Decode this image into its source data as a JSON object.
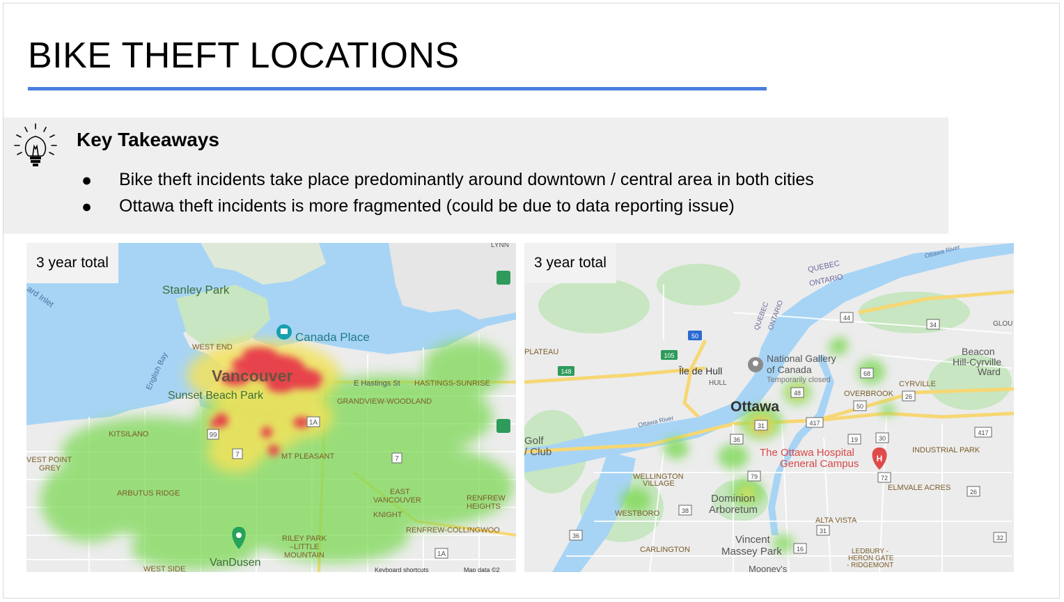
{
  "slide": {
    "title": "BIKE THEFT LOCATIONS",
    "takeaways_heading": "Key Takeaways",
    "bullets": [
      "Bike theft incidents take place predominantly around downtown / central area in both cities",
      "Ottawa theft incidents is more fragmented (could be due to data reporting issue)"
    ],
    "bullet_glyph": "●"
  },
  "vancouver_map": {
    "badge": "3 year total",
    "labels": {
      "stanley_park": "Stanley Park",
      "canada_place": "Canada Place",
      "west_end": "WEST END",
      "vancouver": "Vancouver",
      "sunset_beach": "Sunset Beach Park",
      "english_bay": "English Bay",
      "inlet": "ard Inlet",
      "hastings": "E Hastings St",
      "hastings_sunrise": "HASTINGS-SUNRISE",
      "grandview": "GRANDVIEW-WOODLAND",
      "kitsilano": "KITSILANO",
      "west_point_grey_1": "VEST POINT",
      "west_point_grey_2": "GREY",
      "mt_pleasant": "MT PLEASANT",
      "arbutus": "ARBUTUS RIDGE",
      "east_van_1": "EAST",
      "east_van_2": "VANCOUVER",
      "knight": "KNIGHT",
      "renfrew_1": "RENFREW",
      "renfrew_2": "HEIGHTS",
      "renfrew_collingwood": "RENFREW-COLLINGWOO",
      "riley_1": "RILEY PARK",
      "riley_2": "–LITTLE",
      "riley_3": "MOUNTAIN",
      "vandusen": "VanDusen",
      "west_side": "WEST SIDE",
      "lynn": "LYNN",
      "keyboard": "Keyboard shortcuts",
      "mapdata": "Map data ©2"
    },
    "route_shields": [
      "99",
      "7",
      "1A",
      "7",
      "1A"
    ],
    "heat_hotspot_count": 12
  },
  "ottawa_map": {
    "badge": "3 year total",
    "labels": {
      "quebec_top": "QUEBEC",
      "ontario_top": "ONTARIO",
      "quebec_river": "QUEBEC",
      "ontario_river": "ONTARIO",
      "ottawa_river_top": "Ottawa River",
      "ottawa_river_mid": "Ottawa River",
      "plateau": "PLATEAU",
      "ile_de_hull": "Île de Hull",
      "hull": "HULL",
      "natgal_1": "National Gallery",
      "natgal_2": "of Canada",
      "natgal_3": "Temporarily closed",
      "ottawa": "Ottawa",
      "beacon_1": "Beacon",
      "beacon_2": "Hill-Cyrville",
      "beacon_3": "Ward",
      "cyrville": "CYRVILLE",
      "overbrook": "OVERBROOK",
      "glou": "GLOU",
      "golf_1": "Golf",
      "golf_2": "/ Club",
      "hospital_1": "The Ottawa Hospital",
      "hospital_2": "General Campus",
      "industrial": "INDUSTRIAL PARK",
      "wellington_1": "WELLINGTON",
      "wellington_2": "VILLAGE",
      "westboro": "WESTBORO",
      "dominion_1": "Dominion",
      "dominion_2": "Arboretum",
      "elmvale": "ELMVALE ACRES",
      "alta_vista": "ALTA VISTA",
      "carlington": "CARLINGTON",
      "vincent_1": "Vincent",
      "vincent_2": "Massey Park",
      "ledbury_1": "LEDBURY -",
      "ledbury_2": "HERON GATE",
      "ledbury_3": "- RIDGEMONT",
      "mooneys": "Mooney's"
    },
    "route_shields": [
      "50",
      "105",
      "148",
      "44",
      "34",
      "68",
      "48",
      "50",
      "26",
      "417",
      "19",
      "30",
      "36",
      "31",
      "79",
      "72",
      "26",
      "38",
      "31",
      "36",
      "16",
      "32",
      "417"
    ]
  },
  "colors": {
    "accent_rule": "#4a7fe0",
    "panel_bg": "#efefef",
    "water": "#a7d4f5",
    "land": "#ececec",
    "park": "#c7e6c1",
    "heat_green": "#7ed957",
    "heat_yellow": "#f3e25b",
    "heat_red": "#e6334a"
  }
}
